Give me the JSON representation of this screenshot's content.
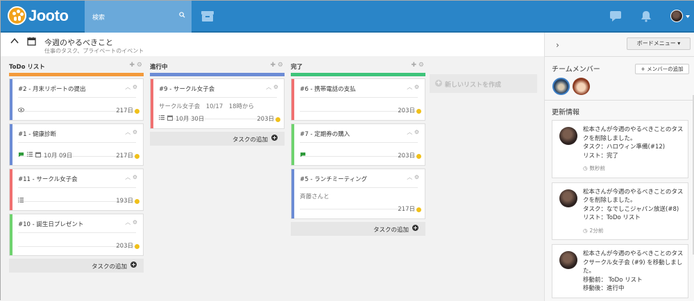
{
  "app": {
    "logo_text": "Jooto"
  },
  "header": {
    "search_placeholder": "検索"
  },
  "board": {
    "title": "今週のやるべきこと",
    "subtitle": "仕事のタスク、プライベートのイベント",
    "new_list_label": "新しいリストを作成",
    "add_task_label": "タスクの追加"
  },
  "columns": [
    {
      "name": "ToDo リスト",
      "color": "#f39a3b",
      "cards": [
        {
          "title": "#2 - 月末リポートの提出",
          "stripe": "#6c8cd5",
          "days": "217日",
          "meta_icons": [
            "eye-icon"
          ]
        },
        {
          "title": "#1 - 健康診断",
          "stripe": "#6c8cd5",
          "days": "217日",
          "meta_icons": [
            "comment-icon",
            "list-icon",
            "calendar-icon"
          ],
          "date": "10月 09日"
        },
        {
          "title": "#11 - サークル女子会",
          "stripe": "#f07070",
          "days": "193日",
          "meta_icons": [
            "list-icon"
          ]
        },
        {
          "title": "#10 - 誕生日プレゼント",
          "stripe": "#6fd36f",
          "days": "203日",
          "meta_icons": []
        }
      ]
    },
    {
      "name": "進行中",
      "color": "#6c8cd5",
      "cards": [
        {
          "title": "#9 - サークル女子会",
          "stripe": "#f07070",
          "days": "203日",
          "desc": "サークル女子会　10/17　18時から",
          "meta_icons": [
            "list-icon",
            "calendar-icon"
          ],
          "date": "10月 30日"
        }
      ]
    },
    {
      "name": "完了",
      "color": "#3ec47a",
      "cards": [
        {
          "title": "#6 - 携帯電話の支払",
          "stripe": "#f07070",
          "days": "203日",
          "meta_icons": []
        },
        {
          "title": "#7 - 定期券の購入",
          "stripe": "#6fd36f",
          "days": "203日",
          "meta_icons": [
            "comment-icon"
          ]
        },
        {
          "title": "#5 - ランチミーティング",
          "stripe": "#6c8cd5",
          "days": "217日",
          "desc": "斉藤さんと",
          "meta_icons": []
        }
      ]
    }
  ],
  "sidebar": {
    "board_menu_label": "ボードメニュー",
    "team_title": "チームメンバー",
    "add_member_label": "+ メンバーの追加",
    "updates_title": "更新情報",
    "feed": [
      {
        "lines": [
          "松本さんが今週のやるべきことのタスクを削除しました。",
          "タスク：ハロウィン準備(#12)",
          "リスト：完了"
        ],
        "time": "数秒前"
      },
      {
        "lines": [
          "松本さんが今週のやるべきことのタスクを削除しました。",
          "タスク：なでしこジャパン放送(#8)",
          "リスト：ToDo リスト"
        ],
        "time": "2分前"
      },
      {
        "lines": [
          "松本さんが今週のやるべきことのタスクサークル女子会 (#9) を移動しました。",
          "移動前： ToDo リスト",
          "移動後：進行中"
        ],
        "time": ""
      }
    ]
  }
}
